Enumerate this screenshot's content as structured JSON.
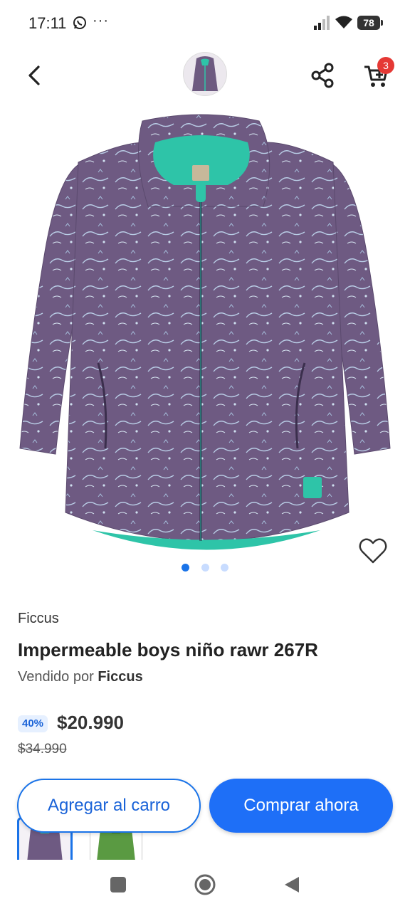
{
  "status_bar": {
    "time": "17:11",
    "more": "···",
    "battery": "78"
  },
  "header": {
    "back_icon": "chevron-left-icon",
    "share_icon": "share-icon",
    "cart_icon": "cart-icon",
    "cart_count": "3"
  },
  "product": {
    "brand": "Ficcus",
    "title": "Impermeable boys niño rawr 267R",
    "seller_prefix": "Vendido por",
    "seller_name": "Ficcus",
    "discount": "40%",
    "price": "$20.990",
    "old_price": "$34.990",
    "image_count": 3,
    "active_image": 1
  },
  "actions": {
    "add_to_cart": "Agregar al carro",
    "buy_now": "Comprar ahora"
  },
  "colors": {
    "accent": "#1a73e8",
    "badge": "#e53935"
  }
}
